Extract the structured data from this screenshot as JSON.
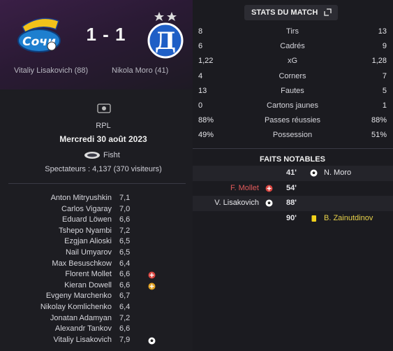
{
  "match": {
    "score": "1 - 1",
    "home_scorer": "Vitaliy Lisakovich (88)",
    "away_scorer": "Nikola Moro (41)",
    "home_logo": "sochi-logo",
    "away_logo": "dynamo-logo"
  },
  "info": {
    "league": "RPL",
    "date": "Mercredi 30 août 2023",
    "stadium": "Fisht",
    "attendance": "Spectateurs : 4,137 (370 visiteurs)"
  },
  "players": [
    {
      "name": "Anton Mitryushkin",
      "rating": "7,1",
      "icon": ""
    },
    {
      "name": "Carlos Vigaray",
      "rating": "7,0",
      "icon": ""
    },
    {
      "name": "Eduard Löwen",
      "rating": "6,6",
      "icon": ""
    },
    {
      "name": "Tshepo Nyambi",
      "rating": "7,2",
      "icon": ""
    },
    {
      "name": "Ezgjan Alioski",
      "rating": "6,5",
      "icon": ""
    },
    {
      "name": "Nail Umyarov",
      "rating": "6,5",
      "icon": ""
    },
    {
      "name": "Max Besuschkow",
      "rating": "6,4",
      "icon": ""
    },
    {
      "name": "Florent Mollet",
      "rating": "6,6",
      "icon": "sub-out-icon"
    },
    {
      "name": "Kieran Dowell",
      "rating": "6,6",
      "icon": "sub-in-icon"
    },
    {
      "name": "Evgeny Marchenko",
      "rating": "6,7",
      "icon": ""
    },
    {
      "name": "Nikolay Komlichenko",
      "rating": "6,4",
      "icon": ""
    },
    {
      "name": "Jonatan Adamyan",
      "rating": "7,2",
      "icon": ""
    },
    {
      "name": "Alexandr Tankov",
      "rating": "6,6",
      "icon": ""
    },
    {
      "name": "Vitaliy Lisakovich",
      "rating": "7,9",
      "icon": "goal-ball-icon"
    }
  ],
  "stats": {
    "title": "STATS DU MATCH",
    "rows": [
      {
        "home": "8",
        "label": "Tirs",
        "away": "13"
      },
      {
        "home": "6",
        "label": "Cadrés",
        "away": "9"
      },
      {
        "home": "1,22",
        "label": "xG",
        "away": "1,28"
      },
      {
        "home": "4",
        "label": "Corners",
        "away": "7"
      },
      {
        "home": "13",
        "label": "Fautes",
        "away": "5"
      },
      {
        "home": "0",
        "label": "Cartons jaunes",
        "away": "1"
      },
      {
        "home": "88%",
        "label": "Passes réussies",
        "away": "88%"
      },
      {
        "home": "49%",
        "label": "Possession",
        "away": "51%"
      }
    ]
  },
  "events": {
    "title": "FAITS NOTABLES",
    "rows": [
      {
        "minute": "41'",
        "left_text": "",
        "left_icon": "",
        "right_icon": "goal-ball-icon",
        "right_text": "N. Moro",
        "right_color": "#e6e6ea"
      },
      {
        "minute": "54'",
        "left_text": "F. Mollet",
        "left_icon": "sub-out-icon",
        "left_color": "#e05a5a",
        "right_icon": "",
        "right_text": ""
      },
      {
        "minute": "88'",
        "left_text": "V. Lisakovich",
        "left_icon": "goal-ball-icon",
        "left_color": "#e6e6ea",
        "right_icon": "",
        "right_text": ""
      },
      {
        "minute": "90'",
        "left_text": "",
        "left_icon": "",
        "right_icon": "yellow-card-icon",
        "right_text": "B. Zainutdinov",
        "right_color": "#e8d24a"
      }
    ]
  },
  "colors": {
    "sub_out": "#d9443f",
    "sub_in": "#e0a020",
    "yellow_card": "#f2d21b",
    "header_gradient": "#3a1f46"
  }
}
